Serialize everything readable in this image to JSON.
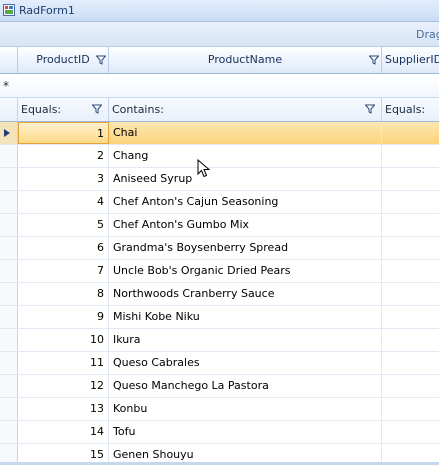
{
  "window": {
    "title": "RadForm1"
  },
  "group_panel": {
    "hint": "Drag"
  },
  "columns": [
    {
      "key": "id",
      "label": "ProductID"
    },
    {
      "key": "name",
      "label": "ProductName"
    },
    {
      "key": "sup",
      "label": "SupplierID"
    }
  ],
  "new_row": {
    "symbol": "*"
  },
  "filters": {
    "id": "Equals:",
    "name": "Contains:",
    "sup": "Equals:"
  },
  "rows": [
    {
      "id": "1",
      "name": "Chai"
    },
    {
      "id": "2",
      "name": "Chang"
    },
    {
      "id": "3",
      "name": "Aniseed Syrup"
    },
    {
      "id": "4",
      "name": "Chef Anton's Cajun Seasoning"
    },
    {
      "id": "5",
      "name": "Chef Anton's Gumbo Mix"
    },
    {
      "id": "6",
      "name": "Grandma's Boysenberry Spread"
    },
    {
      "id": "7",
      "name": "Uncle Bob's Organic Dried Pears"
    },
    {
      "id": "8",
      "name": "Northwoods Cranberry Sauce"
    },
    {
      "id": "9",
      "name": "Mishi Kobe Niku"
    },
    {
      "id": "10",
      "name": "Ikura"
    },
    {
      "id": "11",
      "name": "Queso Cabrales"
    },
    {
      "id": "12",
      "name": "Queso Manchego La Pastora"
    },
    {
      "id": "13",
      "name": "Konbu"
    },
    {
      "id": "14",
      "name": "Tofu"
    },
    {
      "id": "15",
      "name": "Genen Shouyu"
    }
  ],
  "selected_row_index": 0,
  "colors": {
    "accent": "#fbd37a",
    "header_text": "#15305a",
    "border": "#9fb9dc"
  }
}
